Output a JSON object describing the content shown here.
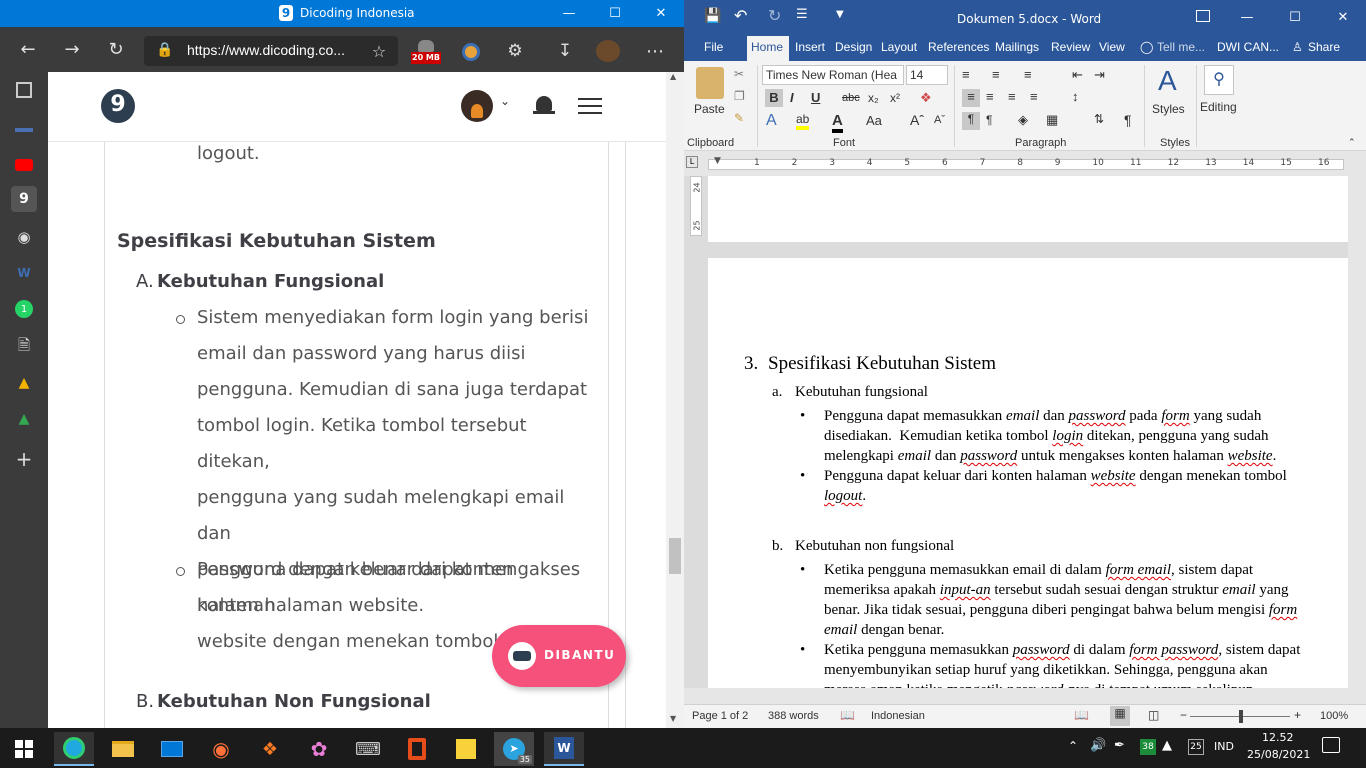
{
  "edge": {
    "title": "Dicoding Indonesia",
    "url": "https://www.dicoding.co...",
    "badge_20": "20 MB",
    "page": {
      "prev_text": "logout.",
      "section_title": "Spesifikasi Kebutuhan Sistem",
      "a_label": "A.",
      "a_title": "Kebutuhan Fungsional",
      "bullet1": [
        "Sistem menyediakan form login yang berisi",
        "email dan password yang harus diisi",
        "pengguna. Kemudian di sana juga terdapat",
        "tombol login. Ketika tombol tersebut ditekan,",
        "pengguna yang sudah melengkapi email dan",
        "password dengan benar dapat mengakses",
        "konten halaman website."
      ],
      "bullet2": [
        "Pengguna dapat keluar dari konten halaman",
        "website dengan menekan tombol logout."
      ],
      "b_label": "B.",
      "b_title": "Kebutuhan Non Fungsional",
      "help_button": "DIBANTU"
    }
  },
  "word": {
    "title": "Dokumen 5.docx - Word",
    "tabs": [
      "File",
      "Home",
      "Insert",
      "Design",
      "Layout",
      "References",
      "Mailings",
      "Review",
      "View"
    ],
    "tell_me": "Tell me...",
    "user": "DWI CAN...",
    "share": "Share",
    "font_name": "Times New Roman (Hea",
    "font_size": "14",
    "groups": {
      "clipboard": "Clipboard",
      "font": "Font",
      "paragraph": "Paragraph",
      "styles": "Styles"
    },
    "paste": "Paste",
    "styles": "Styles",
    "editing": "Editing",
    "ruler_nums": [
      "1",
      "2",
      "3",
      "4",
      "5",
      "6",
      "7",
      "8",
      "9",
      "10",
      "11",
      "12",
      "13",
      "14",
      "15",
      "16"
    ],
    "vruler": [
      "24",
      "25"
    ],
    "doc": {
      "h_num": "3.",
      "h_text": "Spesifikasi Kebutuhan Sistem",
      "a_num": "a.",
      "a_text": "Kebutuhan fungsional",
      "b_num": "b.",
      "b_text": "Kebutuhan non fungsional"
    },
    "status": {
      "page": "Page 1 of 2",
      "words": "388 words",
      "lang": "Indonesian",
      "zoom": "100%"
    }
  },
  "taskbar": {
    "time": "12.52",
    "date": "25/08/2021",
    "lang": "IND",
    "badge_38": "38",
    "badge_25": "25",
    "telegram_badge": "35"
  }
}
